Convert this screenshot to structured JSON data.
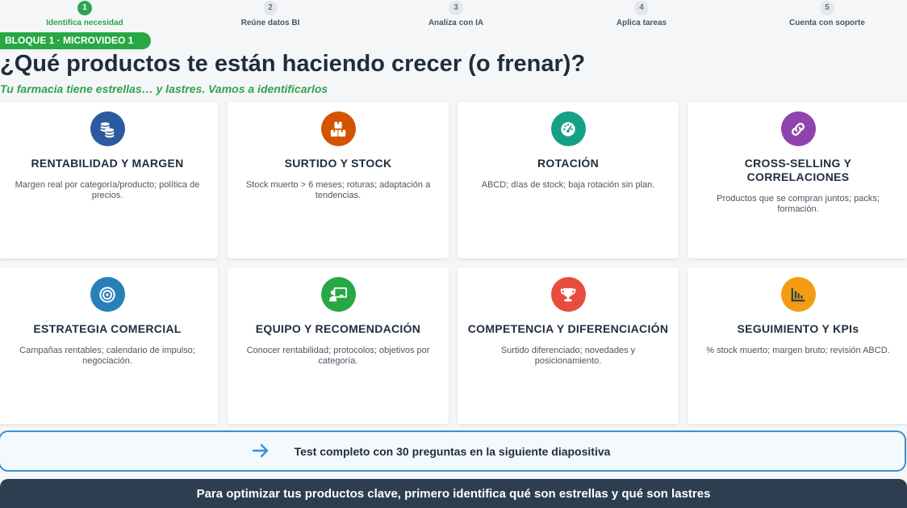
{
  "stepper": {
    "steps": [
      {
        "num": "1",
        "label": "Identifica necesidad"
      },
      {
        "num": "2",
        "label": "Reúne datos BI"
      },
      {
        "num": "3",
        "label": "Analiza con IA"
      },
      {
        "num": "4",
        "label": "Aplica tareas"
      },
      {
        "num": "5",
        "label": "Cuenta con soporte"
      }
    ],
    "active_step": 1
  },
  "badge": "BLOQUE 1 · MICROVIDEO 1",
  "title": "¿Qué productos te están haciendo crecer (o frenar)?",
  "subtitle": "Tu farmacia tiene estrellas… y lastres. Vamos a identificarlos",
  "cards": [
    {
      "title": "RENTABILIDAD Y MARGEN",
      "desc": "Margen real por categoría/producto; política de precios.",
      "icon": "coins-icon",
      "color": "#2c5aa0"
    },
    {
      "title": "SURTIDO Y STOCK",
      "desc": "Stock muerto > 6 meses; roturas; adaptación a tendencias.",
      "icon": "boxes-icon",
      "color": "#d35400"
    },
    {
      "title": "ROTACIÓN",
      "desc": "ABCD; días de stock; baja rotación sin plan.",
      "icon": "gauge-icon",
      "color": "#16a085"
    },
    {
      "title": "CROSS-SELLING Y CORRELACIONES",
      "desc": "Productos que se compran juntos; packs; formación.",
      "icon": "link-icon",
      "color": "#8e44ad"
    },
    {
      "title": "ESTRATEGIA COMERCIAL",
      "desc": "Campañas rentables; calendario de impulso; negociación.",
      "icon": "target-icon",
      "color": "#2980b9"
    },
    {
      "title": "EQUIPO Y RECOMENDACIÓN",
      "desc": "Conocer rentabilidad; protocolos; objetivos por categoría.",
      "icon": "presentation-icon",
      "color": "#27a844"
    },
    {
      "title": "COMPETENCIA Y DIFERENCIACIÓN",
      "desc": "Surtido diferenciado; novedades y posicionamiento.",
      "icon": "trophy-icon",
      "color": "#e74c3c"
    },
    {
      "title": "SEGUIMIENTO Y KPIs",
      "desc": "% stock muerto; margen bruto; revisión ABCD.",
      "icon": "chart-icon",
      "color": "#f39c12"
    }
  ],
  "cta": {
    "text": "Test completo con 30 preguntas en la siguiente diapositiva",
    "icon": "arrow-right-icon",
    "color": "#3d8fd1"
  },
  "footer": "Para optimizar tus productos clave, primero identifica qué son estrellas y qué son lastres"
}
